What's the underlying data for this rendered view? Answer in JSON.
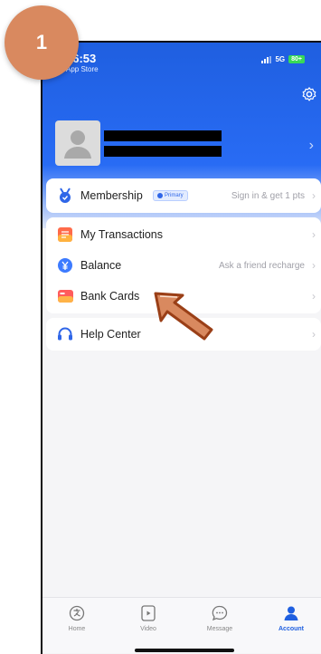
{
  "step": {
    "number": "1"
  },
  "status_bar": {
    "time": "16:53",
    "back_app": "App Store",
    "network": "5G",
    "battery": "80+"
  },
  "account": {
    "membership": {
      "label": "Membership",
      "badge": "Primary",
      "action": "Sign in & get 1 pts"
    },
    "transactions": {
      "label": "My Transactions"
    },
    "balance": {
      "label": "Balance",
      "action": "Ask a friend recharge"
    },
    "bank_cards": {
      "label": "Bank Cards"
    },
    "help": {
      "label": "Help Center"
    }
  },
  "tabbar": {
    "home": "Home",
    "video": "Video",
    "message": "Message",
    "account": "Account"
  },
  "colors": {
    "primary": "#1f5fe0",
    "step_badge": "#d9895f",
    "arrow": "#d9895f"
  },
  "icons": {
    "settings": "gear-icon",
    "membership": "medal-icon",
    "transactions": "transactions-icon",
    "balance": "yuan-coin-icon",
    "bank_cards": "credit-card-icon",
    "help": "headset-icon"
  }
}
